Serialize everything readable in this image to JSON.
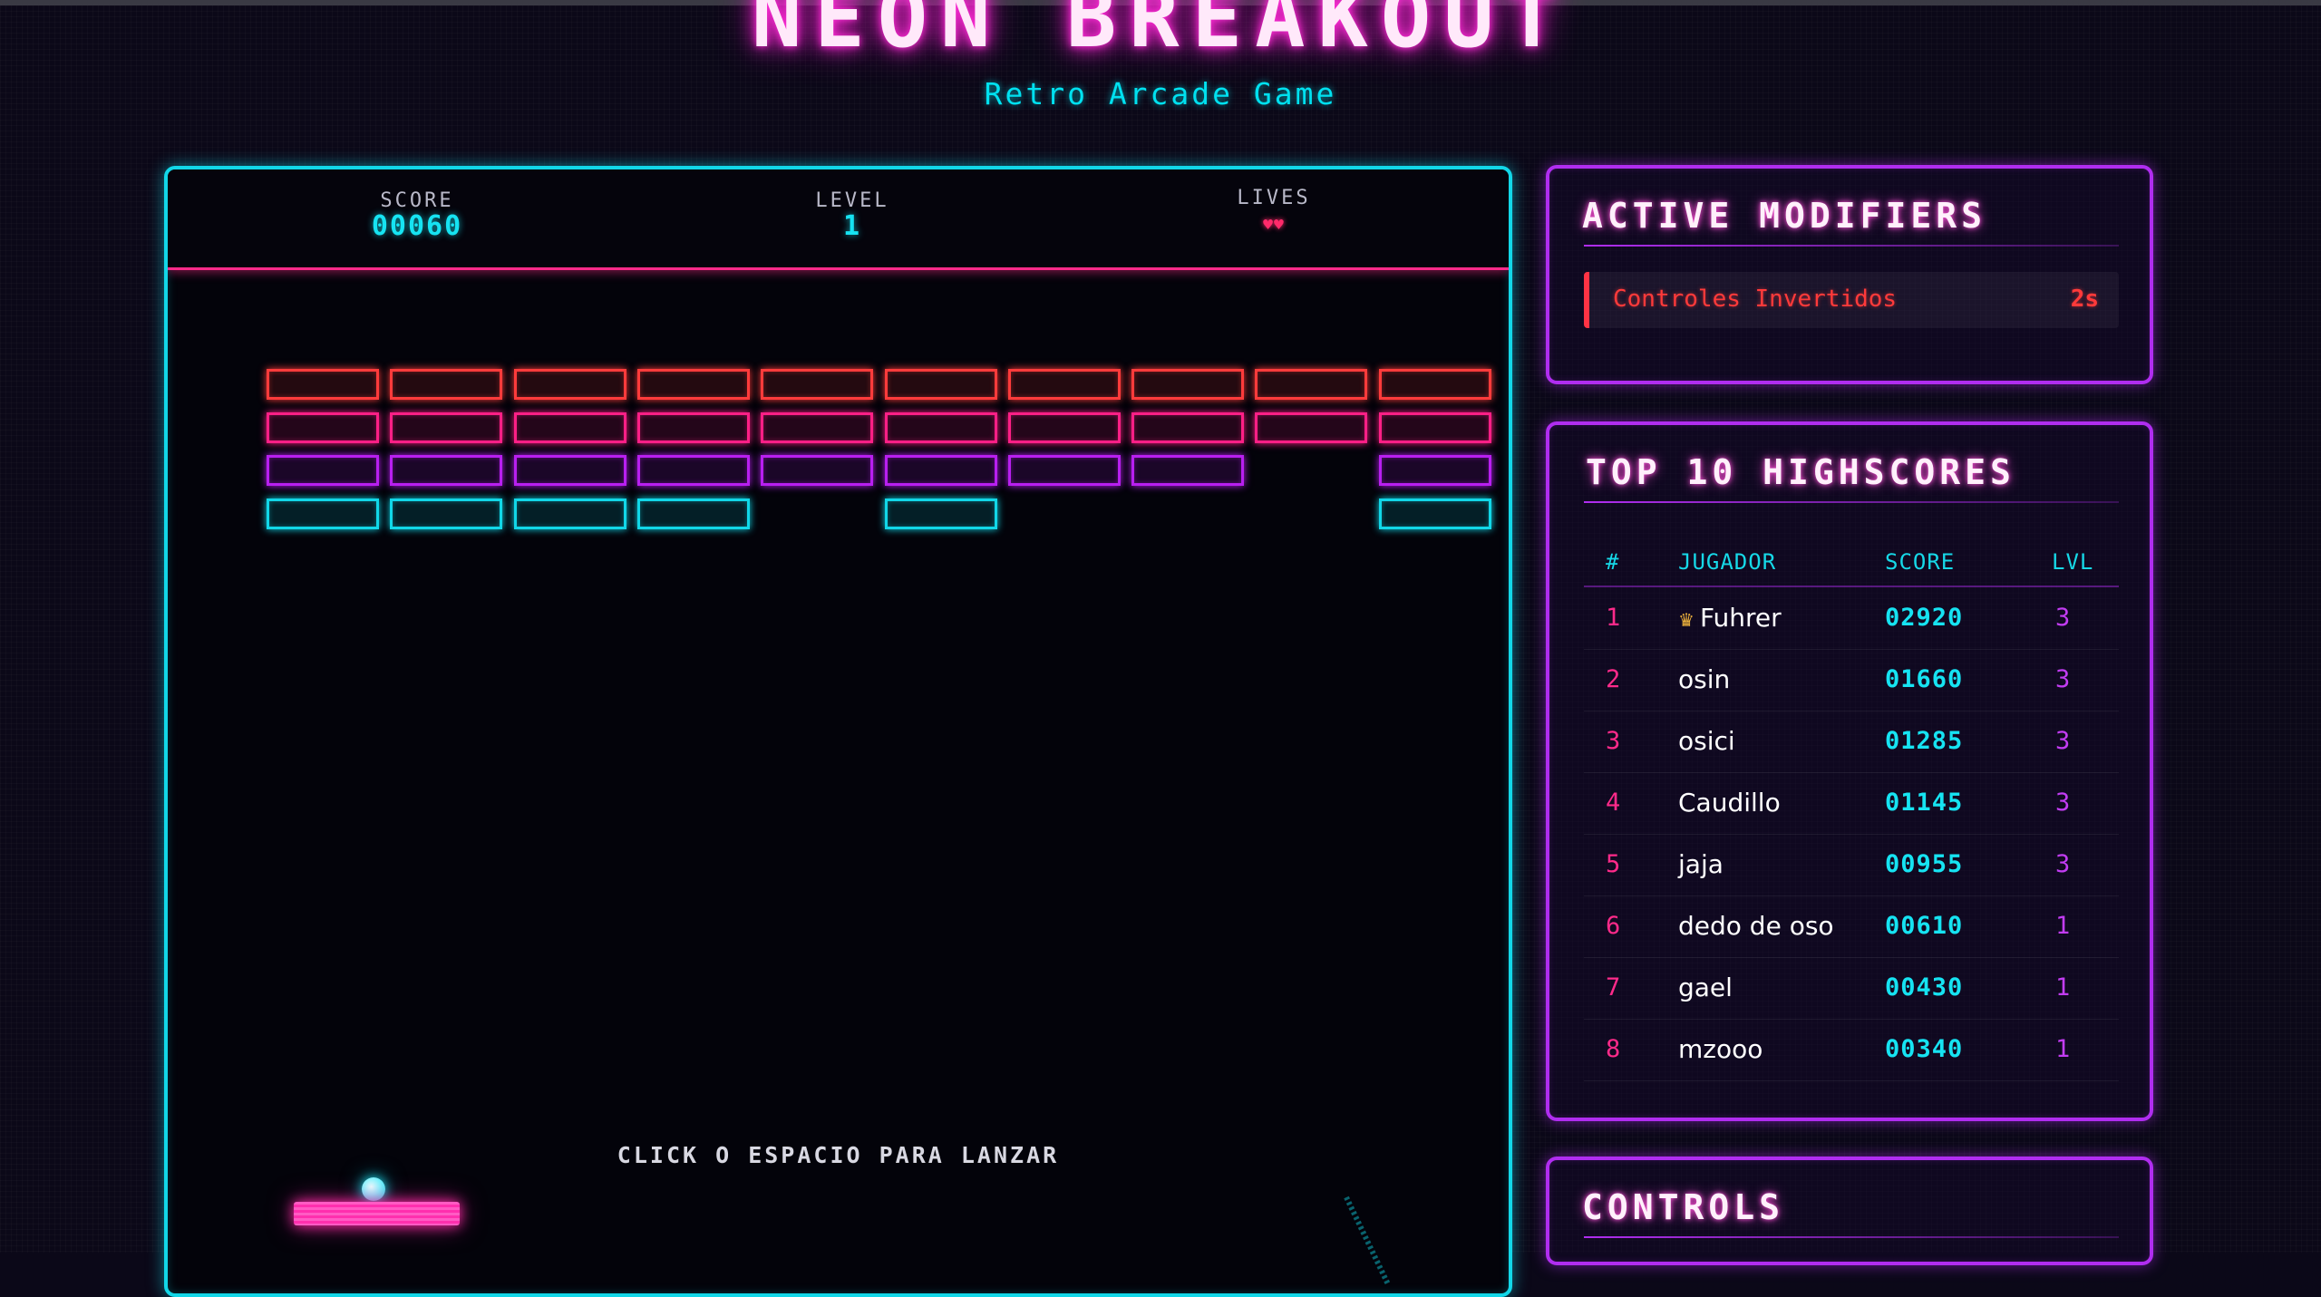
{
  "header": {
    "title": "NEON BREAKOUT",
    "subtitle": "Retro Arcade Game"
  },
  "hud": {
    "score_label": "SCORE",
    "score_value": "00060",
    "level_label": "LEVEL",
    "level_value": "1",
    "lives_label": "LIVES",
    "lives_value": "♥♥"
  },
  "game": {
    "launch_hint": "CLICK O ESPACIO PARA LANZAR",
    "row_colors": [
      "#ff3b3b",
      "#ff1f86",
      "#b81ff0",
      "#11d7e8"
    ],
    "bricks": [
      [
        1,
        1,
        1,
        1,
        1,
        1,
        1,
        1,
        1,
        1
      ],
      [
        1,
        1,
        1,
        1,
        1,
        1,
        1,
        1,
        1,
        1
      ],
      [
        1,
        1,
        1,
        1,
        1,
        1,
        1,
        1,
        0,
        1
      ],
      [
        1,
        1,
        1,
        1,
        0,
        1,
        0,
        0,
        0,
        1
      ]
    ]
  },
  "modifiers": {
    "title": "ACTIVE MODIFIERS",
    "items": [
      {
        "name": "Controles Invertidos",
        "time": "2s",
        "color": "#ff3344"
      }
    ]
  },
  "highscores": {
    "title": "TOP 10 HIGHSCORES",
    "columns": {
      "rank": "#",
      "player": "JUGADOR",
      "score": "SCORE",
      "level": "LVL"
    },
    "rows": [
      {
        "rank": "1",
        "player": "Fuhrer",
        "score": "02920",
        "level": "3"
      },
      {
        "rank": "2",
        "player": "osin",
        "score": "01660",
        "level": "3"
      },
      {
        "rank": "3",
        "player": "osici",
        "score": "01285",
        "level": "3"
      },
      {
        "rank": "4",
        "player": "Caudillo",
        "score": "01145",
        "level": "3"
      },
      {
        "rank": "5",
        "player": "jaja",
        "score": "00955",
        "level": "3"
      },
      {
        "rank": "6",
        "player": "dedo de oso",
        "score": "00610",
        "level": "1"
      },
      {
        "rank": "7",
        "player": "gael",
        "score": "00430",
        "level": "1"
      },
      {
        "rank": "8",
        "player": "mzooo",
        "score": "00340",
        "level": "1"
      }
    ]
  },
  "controls": {
    "title": "CONTROLS"
  },
  "colors": {
    "accent_cyan": "#12d7e8",
    "accent_magenta": "#ff2bd6",
    "accent_purple": "#b02df0",
    "background": "#0b0818"
  }
}
